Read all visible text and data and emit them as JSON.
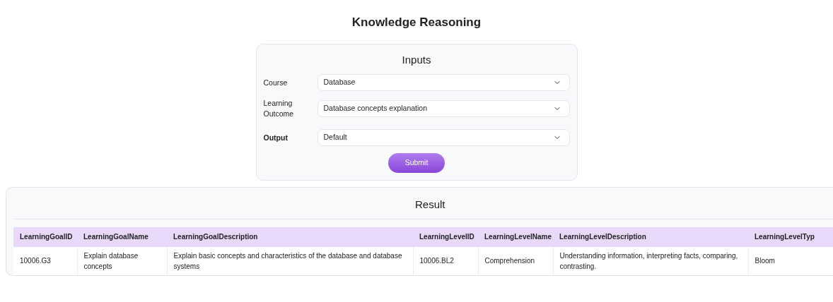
{
  "page_title": "Knowledge Reasoning",
  "inputs": {
    "title": "Inputs",
    "fields": [
      {
        "label": "Course",
        "value": "Database",
        "bold": false
      },
      {
        "label": "Learning Outcome",
        "value": "Database concepts explanation",
        "bold": false
      },
      {
        "label": "Output",
        "value": "Default",
        "bold": true
      }
    ],
    "submit": "Submit"
  },
  "result": {
    "title": "Result",
    "columns": [
      "LearningGoalID",
      "LearningGoalName",
      "LearningGoalDescription",
      "LearningLevelID",
      "LearningLevelName",
      "LearningLevelDescription",
      "LearningLevelTyp"
    ],
    "rows": [
      [
        "10006.G3",
        "Explain database concepts",
        "Explain basic concepts and characteristics of the database and database systems",
        "10006.BL2",
        "Comprehension",
        "Understanding information, interpreting facts, comparing, contrasting.",
        "Bloom"
      ]
    ]
  }
}
